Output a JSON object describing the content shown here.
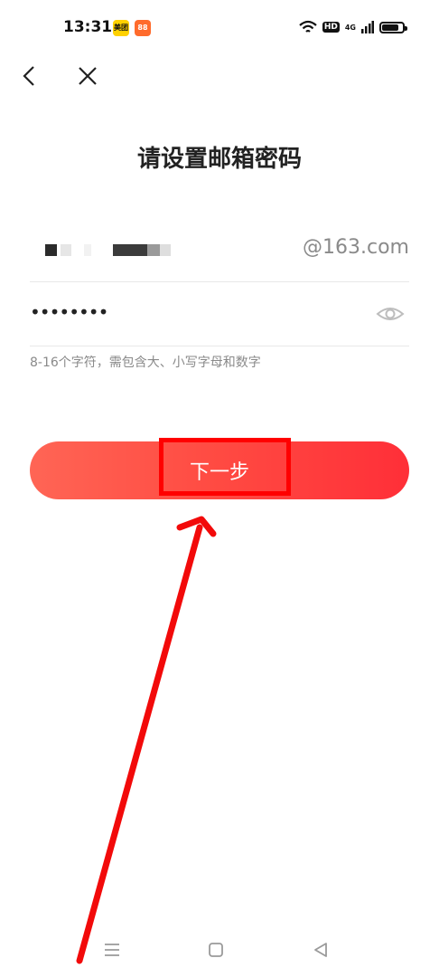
{
  "status_bar": {
    "time": "13:31",
    "app_badges": [
      "美团",
      "88"
    ],
    "hd_label": "HD",
    "network_label": "4G",
    "battery_level": 0.85
  },
  "page": {
    "title": "请设置邮箱密码",
    "email_suffix": "@163.com",
    "password_masked": "••••••••",
    "hint": "8-16个字符，需包含大、小写字母和数字",
    "next_button_label": "下一步"
  },
  "colors": {
    "primary_red": "#ff3b3b",
    "highlight": "#ff0000",
    "hint_gray": "#8a8a8a"
  },
  "icons": {
    "back": "chevron-left-icon",
    "close": "close-icon",
    "eye": "eye-icon",
    "wifi": "wifi-icon",
    "signal": "signal-icon",
    "battery": "battery-icon",
    "menu": "menu-icon",
    "home": "home-icon",
    "nav_back": "triangle-back-icon"
  }
}
